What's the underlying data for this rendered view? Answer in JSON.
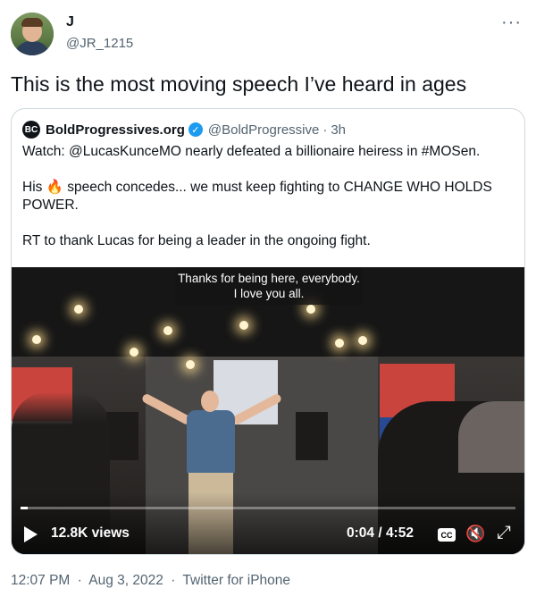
{
  "tweet": {
    "display_name": "J",
    "handle": "@JR_1215",
    "more_icon": "more-horizontal-icon",
    "text": "This is the most moving speech I’ve heard in ages",
    "timestamp": "12:07 PM",
    "date": "Aug 3, 2022",
    "source": "Twitter for iPhone",
    "separator": "·"
  },
  "quote": {
    "name": "BoldProgressives.org",
    "logo_text": "BC",
    "handle": "@BoldProgressive",
    "separator": "·",
    "time": "3h",
    "lines": [
      "Watch: @LucasKunceMO nearly defeated a billionaire heiress in #MOSen.",
      "His 🔥 speech concedes... we must keep fighting to CHANGE WHO HOLDS POWER.",
      "RT to thank Lucas for being a leader in the ongoing fight."
    ]
  },
  "video": {
    "caption_line1": "Thanks for being here, everybody.",
    "caption_line2": "I love you all.",
    "views": "12.8K views",
    "time": "0:04 / 4:52",
    "cc_label": "CC",
    "progress": 0.014,
    "mute_icon": "🔇",
    "expand_icon": "⤢",
    "accent": "#1d9bf0"
  }
}
